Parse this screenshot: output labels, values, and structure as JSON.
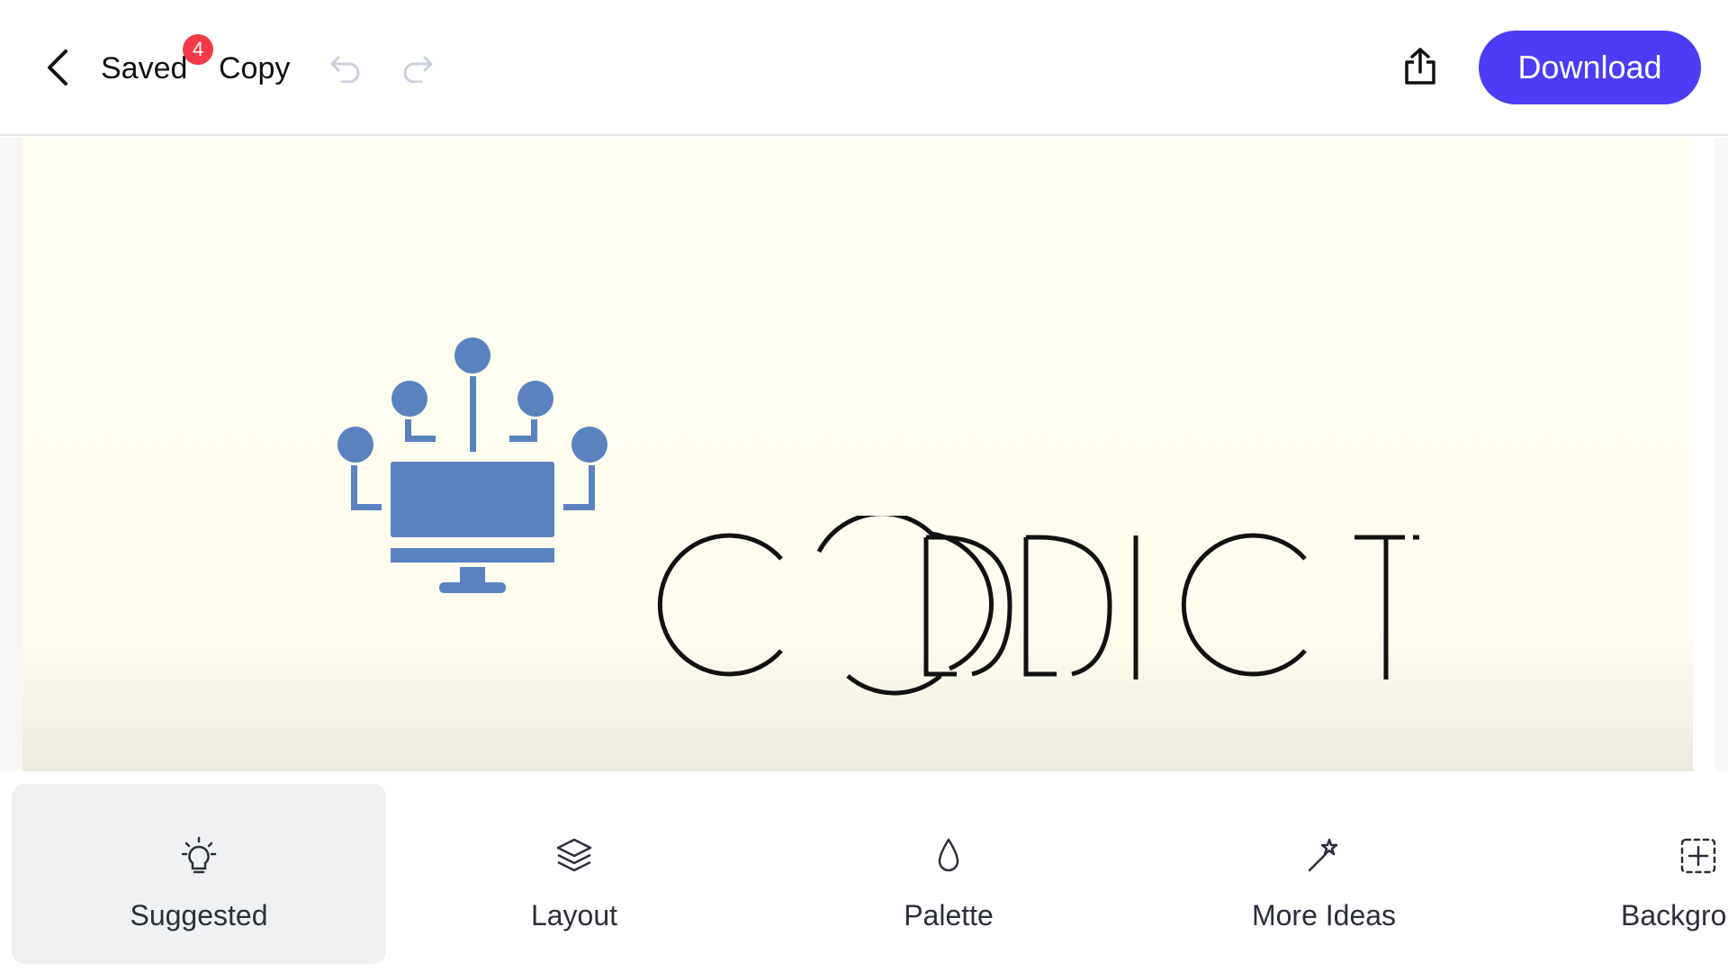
{
  "header": {
    "saved_label": "Saved",
    "badge_count": "4",
    "copy_label": "Copy",
    "download_label": "Download"
  },
  "canvas": {
    "logo_text": "CODDICT",
    "brand_color": "#5a82bf",
    "background_color": "#fffef0"
  },
  "toolbar": {
    "items": [
      {
        "label": "Suggested",
        "icon": "lightbulb-icon",
        "active": true
      },
      {
        "label": "Layout",
        "icon": "layers-icon",
        "active": false
      },
      {
        "label": "Palette",
        "icon": "droplet-icon",
        "active": false
      },
      {
        "label": "More Ideas",
        "icon": "magic-wand-icon",
        "active": false
      },
      {
        "label": "Backgro",
        "icon": "background-grid-icon",
        "active": false
      }
    ]
  },
  "colors": {
    "accent": "#4d3cf5",
    "badge": "#f23b47"
  }
}
